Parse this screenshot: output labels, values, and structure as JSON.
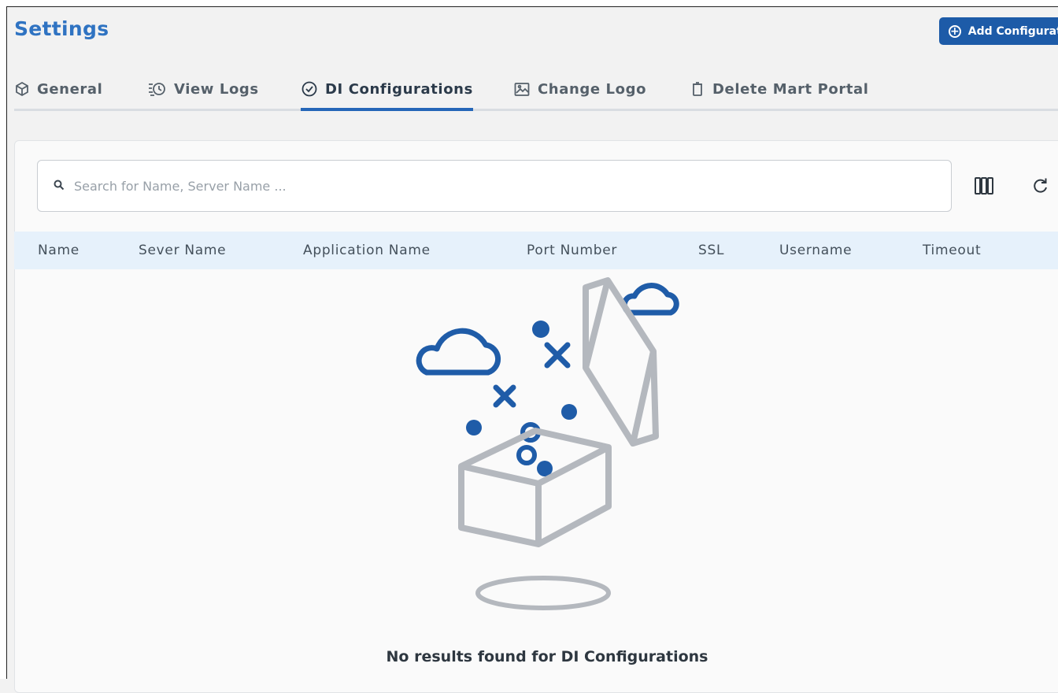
{
  "page": {
    "title": "Settings"
  },
  "header": {
    "add_button_label": "Add Configuration"
  },
  "tabs": [
    {
      "label": "General",
      "icon": "cube-icon"
    },
    {
      "label": "View Logs",
      "icon": "history-icon"
    },
    {
      "label": "DI Configurations",
      "icon": "check-circle-icon",
      "active": true
    },
    {
      "label": "Change Logo",
      "icon": "image-icon"
    },
    {
      "label": "Delete Mart Portal",
      "icon": "trash-icon"
    }
  ],
  "search": {
    "placeholder": "Search for Name, Server Name ..."
  },
  "toolbar": {
    "columns_icon": "columns-icon",
    "refresh_icon": "refresh-icon"
  },
  "table": {
    "columns": [
      "Name",
      "Sever Name",
      "Application Name",
      "Port Number",
      "SSL",
      "Username",
      "Timeout"
    ]
  },
  "empty_state": {
    "message": "No results found for DI Configurations"
  },
  "colors": {
    "accent": "#2566b8",
    "title": "#2f73c2",
    "button": "#1d5ba8",
    "header_bg": "#e6f1fb",
    "illustration_gray": "#b4b8be",
    "illustration_blue": "#1f5ca8"
  }
}
